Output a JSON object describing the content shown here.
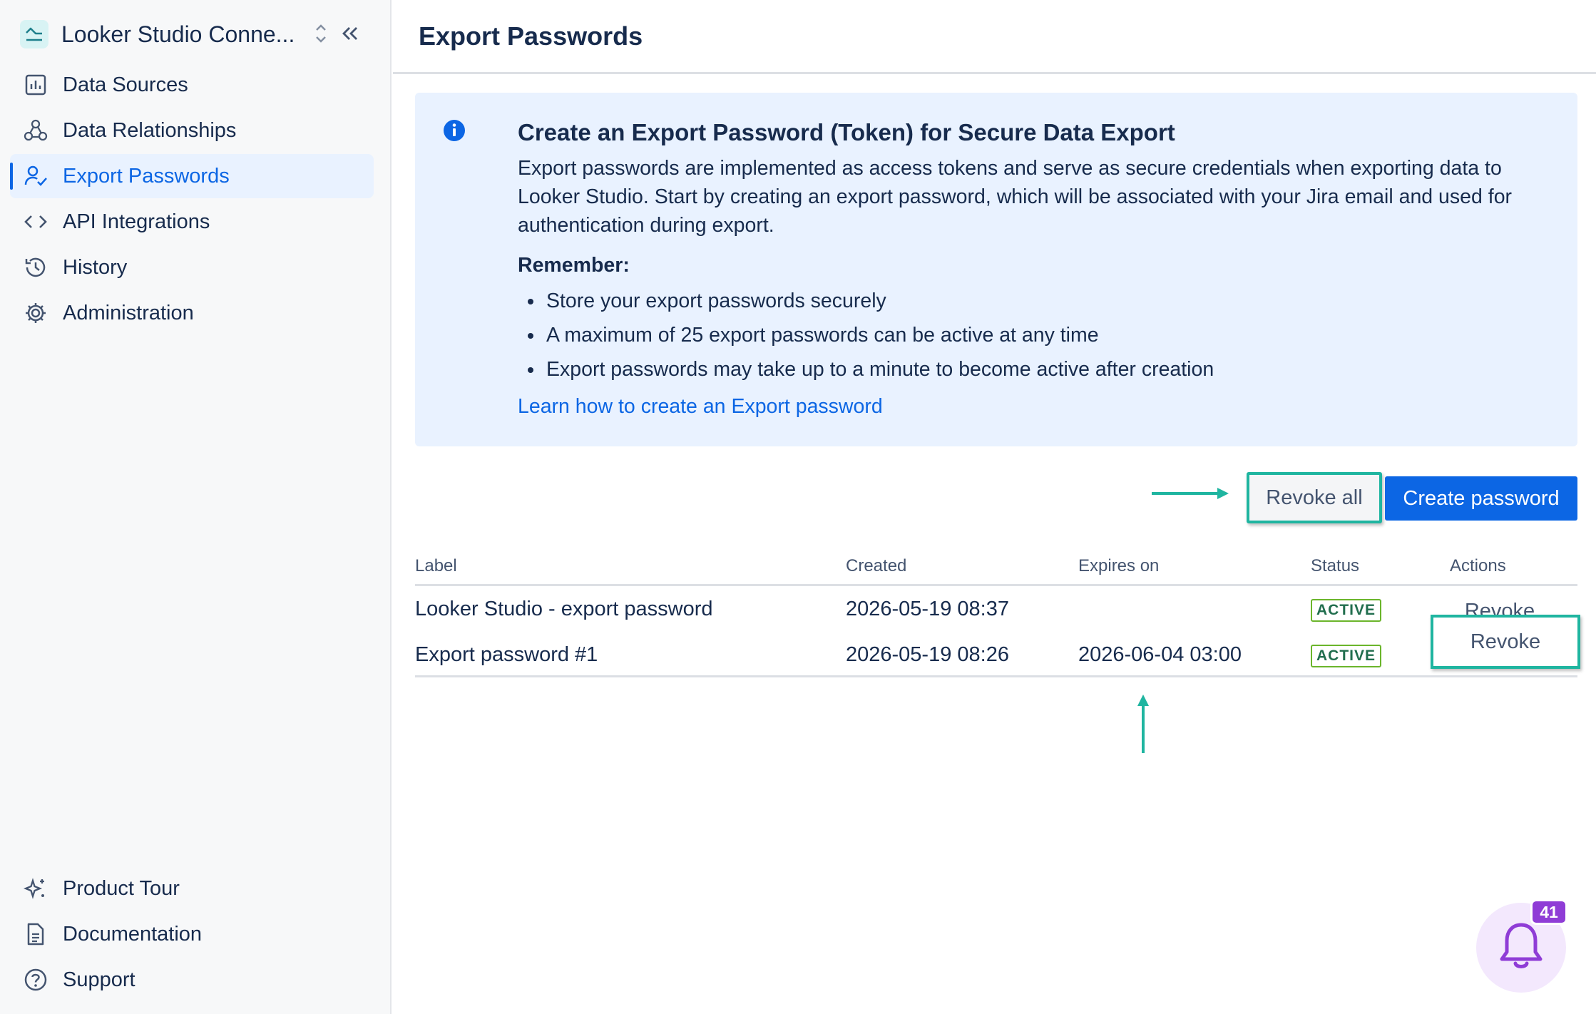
{
  "app": {
    "title": "Looker Studio Conne...",
    "logo_icon": "line-chart-icon",
    "accent_color": "#0c66e4",
    "highlight_color": "#1fb5a0"
  },
  "sidebar": {
    "items": [
      {
        "label": "Data Sources",
        "icon": "bar-chart-icon"
      },
      {
        "label": "Data Relationships",
        "icon": "webhook-icon"
      },
      {
        "label": "Export Passwords",
        "icon": "person-check-icon",
        "active": true
      },
      {
        "label": "API Integrations",
        "icon": "code-icon"
      },
      {
        "label": "History",
        "icon": "history-icon"
      },
      {
        "label": "Administration",
        "icon": "gear-icon"
      }
    ],
    "bottom_items": [
      {
        "label": "Product Tour",
        "icon": "sparkle-icon"
      },
      {
        "label": "Documentation",
        "icon": "document-icon"
      },
      {
        "label": "Support",
        "icon": "question-icon"
      }
    ]
  },
  "page": {
    "title": "Export Passwords"
  },
  "info": {
    "title": "Create an Export Password (Token) for Secure Data Export",
    "description": "Export passwords are implemented as access tokens and serve as secure credentials when exporting data to Looker Studio. Start by creating an export password, which will be associated with your Jira email and used for authentication during export.",
    "remember_label": "Remember:",
    "bullets": [
      "Store your export passwords securely",
      "A maximum of 25 export passwords can be active at any time",
      "Export passwords may take up to a minute to become active after creation"
    ],
    "link_text": "Learn how to create an Export password"
  },
  "actions": {
    "revoke_all_label": "Revoke all",
    "create_label": "Create password"
  },
  "table": {
    "headers": {
      "label": "Label",
      "created": "Created",
      "expires": "Expires on",
      "status": "Status",
      "actions": "Actions"
    },
    "rows": [
      {
        "label": "Looker Studio - export password",
        "created": "2026-05-19 08:37",
        "expires": "",
        "status": "ACTIVE",
        "action": "Revoke"
      },
      {
        "label": "Export password #1",
        "created": "2026-05-19 08:26",
        "expires": "2026-06-04 03:00",
        "status": "ACTIVE",
        "action": "Revoke"
      }
    ]
  },
  "notifications": {
    "count": "41",
    "icon": "bell-icon"
  }
}
